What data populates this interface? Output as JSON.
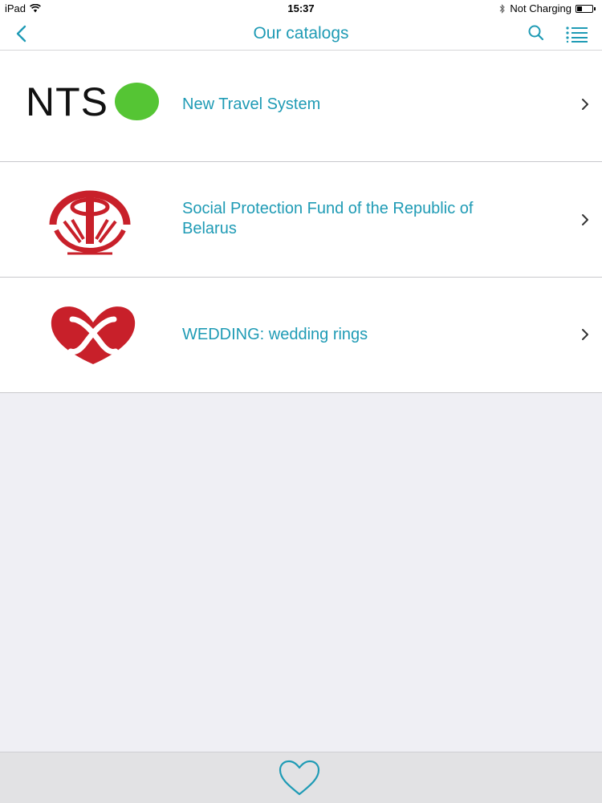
{
  "status_bar": {
    "device": "iPad",
    "time": "15:37",
    "charging": "Not Charging",
    "battery_level": 0.35
  },
  "nav": {
    "title": "Our catalogs",
    "icons": [
      "chevron-left-icon",
      "search-icon",
      "list-menu-icon"
    ]
  },
  "catalogs": [
    {
      "logo_text": "NTS",
      "title": "New Travel System"
    },
    {
      "title": "Social Protection Fund of the Republic of Belarus"
    },
    {
      "title": "WEDDING: wedding rings"
    }
  ],
  "tab_bar": {
    "icons": [
      "heart-icon"
    ]
  },
  "colors": {
    "accent": "#1f9bb5",
    "nts_green": "#55c534",
    "logo_red": "#c8202a",
    "background": "#efeff4"
  }
}
